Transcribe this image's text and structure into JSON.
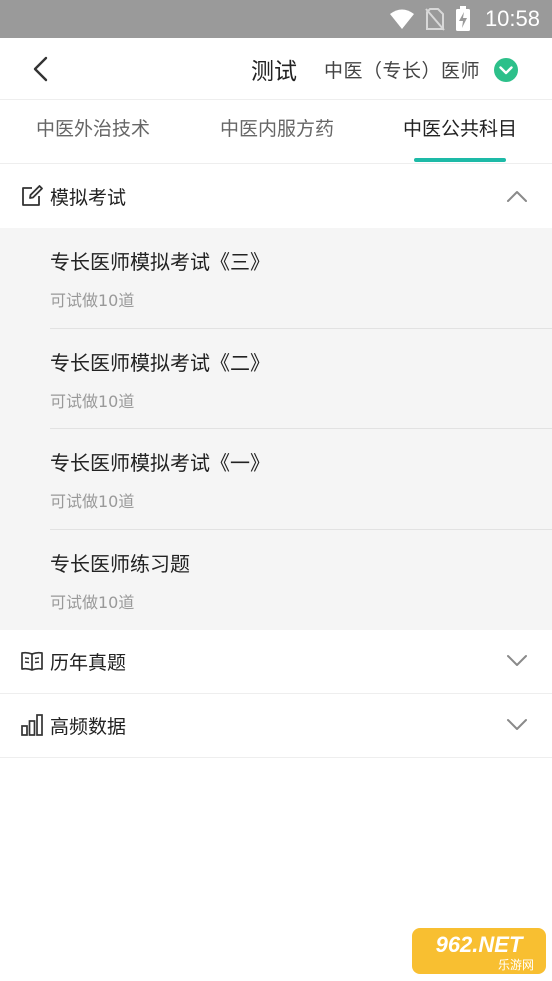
{
  "status_bar": {
    "time": "10:58"
  },
  "nav": {
    "title": "测试",
    "subject": "中医（专长）医师"
  },
  "tabs": [
    {
      "label": "中医外治技术"
    },
    {
      "label": "中医内服方药"
    },
    {
      "label": "中医公共科目"
    }
  ],
  "sections": {
    "mock_exam": {
      "title": "模拟考试",
      "items": [
        {
          "title": "专长医师模拟考试《三》",
          "subtitle": "可试做10道"
        },
        {
          "title": "专长医师模拟考试《二》",
          "subtitle": "可试做10道"
        },
        {
          "title": "专长医师模拟考试《一》",
          "subtitle": "可试做10道"
        },
        {
          "title": "专长医师练习题",
          "subtitle": "可试做10道"
        }
      ]
    },
    "past_exams": {
      "title": "历年真题"
    },
    "frequency_data": {
      "title": "高频数据"
    }
  },
  "watermark": {
    "text": "962.NET",
    "subtext": "乐游网"
  },
  "colors": {
    "accent": "#1dbaa7",
    "status_bar": "#9a9a9a",
    "list_bg": "#f5f5f5"
  }
}
